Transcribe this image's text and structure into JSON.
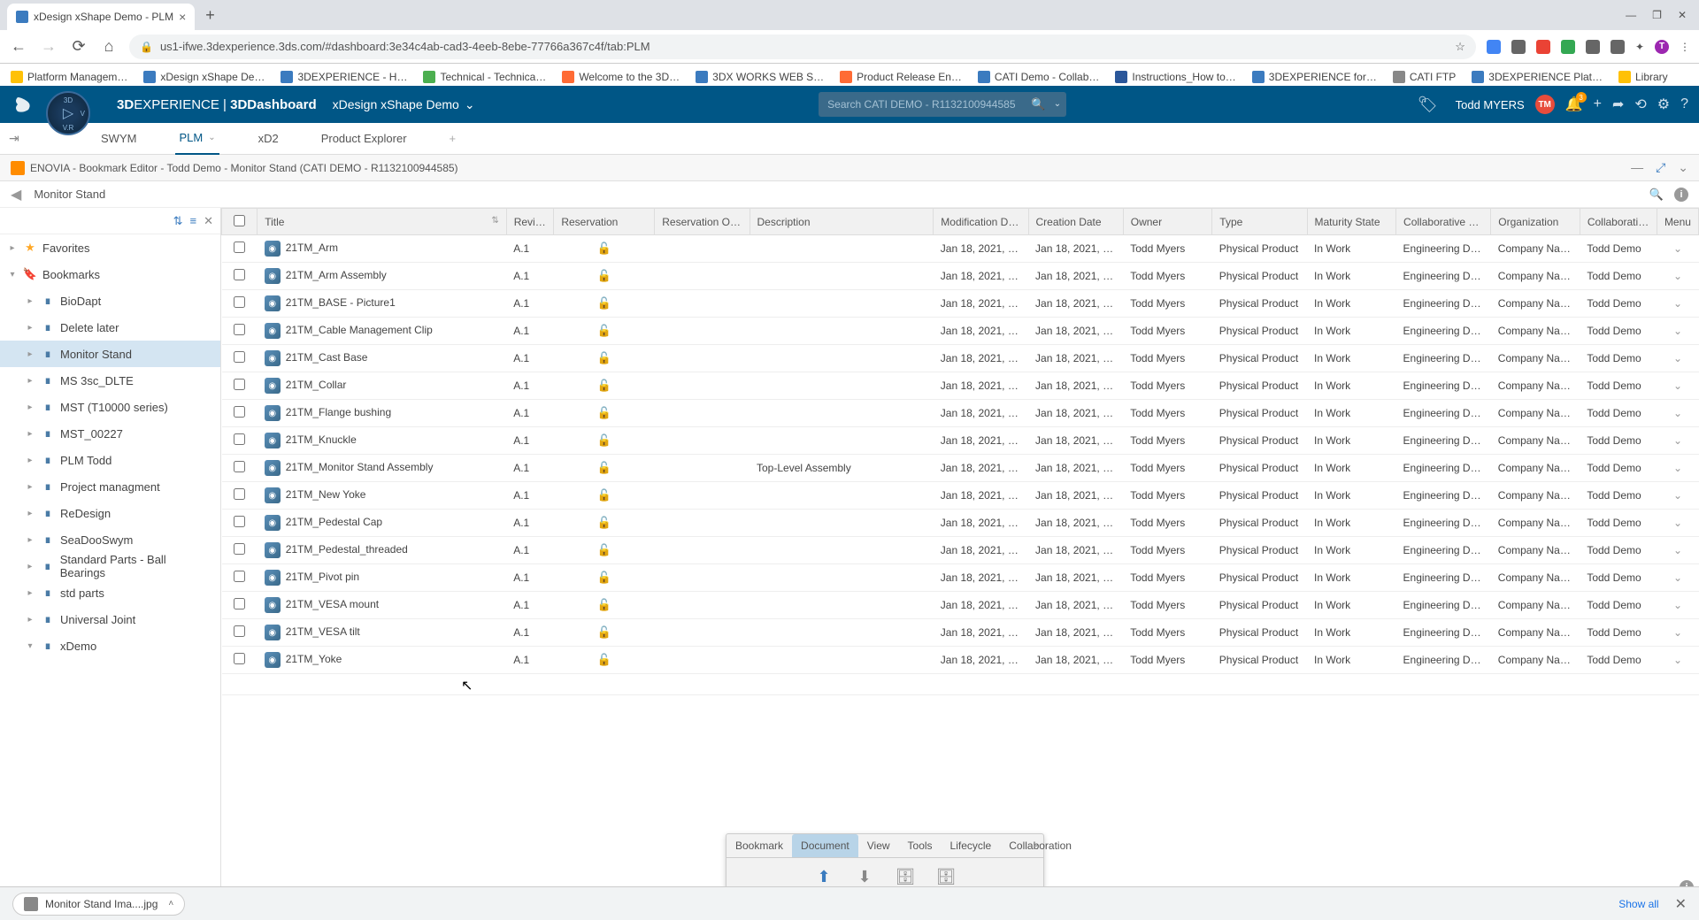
{
  "browser": {
    "tabTitle": "xDesign xShape Demo - PLM",
    "url": "us1-ifwe.3dexperience.3ds.com/#dashboard:3e34c4ab-cad3-4eeb-8ebe-77766a367c4f/tab:PLM",
    "bookmarks": [
      "Platform Managem…",
      "xDesign xShape De…",
      "3DEXPERIENCE - H…",
      "Technical - Technica…",
      "Welcome to the 3D…",
      "3DX WORKS WEB S…",
      "Product Release En…",
      "CATI Demo - Collab…",
      "Instructions_How to…",
      "3DEXPERIENCE for…",
      "CATI FTP",
      "3DEXPERIENCE Plat…",
      "Library"
    ]
  },
  "header": {
    "brandBold": "3D",
    "brandRest": "EXPERIENCE | ",
    "brandApp": "3DDashboard",
    "appName": "xDesign xShape Demo",
    "searchPlaceholder": "Search CATI DEMO - R1132100944585",
    "userName": "Todd MYERS",
    "userInitials": "TM",
    "notifCount": "3"
  },
  "tabs": [
    "SWYM",
    "PLM",
    "xD2",
    "Product Explorer"
  ],
  "widget": {
    "title": "ENOVIA - Bookmark Editor - Todd Demo - Monitor Stand (CATI DEMO - R1132100944585)"
  },
  "breadcrumb": "Monitor Stand",
  "sidebar": {
    "favorites": "Favorites",
    "bookmarks": "Bookmarks",
    "items": [
      "BioDapt",
      "Delete later",
      "Monitor Stand",
      "MS 3sc_DLTE",
      "MST (T10000 series)",
      "MST_00227",
      "PLM Todd",
      "Project managment",
      "ReDesign",
      "SeaDooSwym",
      "Standard Parts - Ball Bearings",
      "std parts",
      "Universal Joint",
      "xDemo"
    ],
    "selectedIndex": 2
  },
  "columns": [
    "",
    "Title",
    "Revi…",
    "Reservation",
    "Reservation O…",
    "Description",
    "Modification D…",
    "Creation Date",
    "Owner",
    "Type",
    "Maturity State",
    "Collaborative …",
    "Organization",
    "Collaborative …",
    "Menu"
  ],
  "rows": [
    {
      "title": "21TM_Arm",
      "rev": "A.1",
      "desc": "",
      "mod": "Jan 18, 2021, …",
      "cre": "Jan 18, 2021, …",
      "owner": "Todd Myers",
      "type": "Physical Product",
      "mat": "In Work",
      "pol": "Engineering D…",
      "org": "Company Name",
      "collab": "Todd Demo"
    },
    {
      "title": "21TM_Arm Assembly",
      "rev": "A.1",
      "desc": "",
      "mod": "Jan 18, 2021, …",
      "cre": "Jan 18, 2021, …",
      "owner": "Todd Myers",
      "type": "Physical Product",
      "mat": "In Work",
      "pol": "Engineering D…",
      "org": "Company Name",
      "collab": "Todd Demo"
    },
    {
      "title": "21TM_BASE - Picture1",
      "rev": "A.1",
      "desc": "",
      "mod": "Jan 18, 2021, …",
      "cre": "Jan 18, 2021, …",
      "owner": "Todd Myers",
      "type": "Physical Product",
      "mat": "In Work",
      "pol": "Engineering D…",
      "org": "Company Name",
      "collab": "Todd Demo"
    },
    {
      "title": "21TM_Cable Management Clip",
      "rev": "A.1",
      "desc": "",
      "mod": "Jan 18, 2021, …",
      "cre": "Jan 18, 2021, …",
      "owner": "Todd Myers",
      "type": "Physical Product",
      "mat": "In Work",
      "pol": "Engineering D…",
      "org": "Company Name",
      "collab": "Todd Demo"
    },
    {
      "title": "21TM_Cast Base",
      "rev": "A.1",
      "desc": "",
      "mod": "Jan 18, 2021, …",
      "cre": "Jan 18, 2021, …",
      "owner": "Todd Myers",
      "type": "Physical Product",
      "mat": "In Work",
      "pol": "Engineering D…",
      "org": "Company Name",
      "collab": "Todd Demo"
    },
    {
      "title": "21TM_Collar",
      "rev": "A.1",
      "desc": "",
      "mod": "Jan 18, 2021, …",
      "cre": "Jan 18, 2021, …",
      "owner": "Todd Myers",
      "type": "Physical Product",
      "mat": "In Work",
      "pol": "Engineering D…",
      "org": "Company Name",
      "collab": "Todd Demo"
    },
    {
      "title": "21TM_Flange bushing",
      "rev": "A.1",
      "desc": "",
      "mod": "Jan 18, 2021, …",
      "cre": "Jan 18, 2021, …",
      "owner": "Todd Myers",
      "type": "Physical Product",
      "mat": "In Work",
      "pol": "Engineering D…",
      "org": "Company Name",
      "collab": "Todd Demo"
    },
    {
      "title": "21TM_Knuckle",
      "rev": "A.1",
      "desc": "",
      "mod": "Jan 18, 2021, …",
      "cre": "Jan 18, 2021, …",
      "owner": "Todd Myers",
      "type": "Physical Product",
      "mat": "In Work",
      "pol": "Engineering D…",
      "org": "Company Name",
      "collab": "Todd Demo"
    },
    {
      "title": "21TM_Monitor Stand Assembly",
      "rev": "A.1",
      "desc": "Top-Level Assembly",
      "mod": "Jan 18, 2021, …",
      "cre": "Jan 18, 2021, …",
      "owner": "Todd Myers",
      "type": "Physical Product",
      "mat": "In Work",
      "pol": "Engineering D…",
      "org": "Company Name",
      "collab": "Todd Demo"
    },
    {
      "title": "21TM_New Yoke",
      "rev": "A.1",
      "desc": "",
      "mod": "Jan 18, 2021, …",
      "cre": "Jan 18, 2021, …",
      "owner": "Todd Myers",
      "type": "Physical Product",
      "mat": "In Work",
      "pol": "Engineering D…",
      "org": "Company Name",
      "collab": "Todd Demo"
    },
    {
      "title": "21TM_Pedestal Cap",
      "rev": "A.1",
      "desc": "",
      "mod": "Jan 18, 2021, …",
      "cre": "Jan 18, 2021, …",
      "owner": "Todd Myers",
      "type": "Physical Product",
      "mat": "In Work",
      "pol": "Engineering D…",
      "org": "Company Name",
      "collab": "Todd Demo"
    },
    {
      "title": "21TM_Pedestal_threaded",
      "rev": "A.1",
      "desc": "",
      "mod": "Jan 18, 2021, …",
      "cre": "Jan 18, 2021, …",
      "owner": "Todd Myers",
      "type": "Physical Product",
      "mat": "In Work",
      "pol": "Engineering D…",
      "org": "Company Name",
      "collab": "Todd Demo"
    },
    {
      "title": "21TM_Pivot pin",
      "rev": "A.1",
      "desc": "",
      "mod": "Jan 18, 2021, …",
      "cre": "Jan 18, 2021, …",
      "owner": "Todd Myers",
      "type": "Physical Product",
      "mat": "In Work",
      "pol": "Engineering D…",
      "org": "Company Name",
      "collab": "Todd Demo"
    },
    {
      "title": "21TM_VESA mount",
      "rev": "A.1",
      "desc": "",
      "mod": "Jan 18, 2021, …",
      "cre": "Jan 18, 2021, …",
      "owner": "Todd Myers",
      "type": "Physical Product",
      "mat": "In Work",
      "pol": "Engineering D…",
      "org": "Company Name",
      "collab": "Todd Demo"
    },
    {
      "title": "21TM_VESA tilt",
      "rev": "A.1",
      "desc": "",
      "mod": "Jan 18, 2021, …",
      "cre": "Jan 18, 2021, …",
      "owner": "Todd Myers",
      "type": "Physical Product",
      "mat": "In Work",
      "pol": "Engineering D…",
      "org": "Company Name",
      "collab": "Todd Demo"
    },
    {
      "title": "21TM_Yoke",
      "rev": "A.1",
      "desc": "",
      "mod": "Jan 18, 2021, …",
      "cre": "Jan 18, 2021, …",
      "owner": "Todd Myers",
      "type": "Physical Product",
      "mat": "In Work",
      "pol": "Engineering D…",
      "org": "Company Name",
      "collab": "Todd Demo"
    }
  ],
  "floatToolbar": {
    "tabs": [
      "Bookmark",
      "Document",
      "View",
      "Tools",
      "Lifecycle",
      "Collaboration"
    ],
    "activeTab": 1
  },
  "download": {
    "filename": "Monitor Stand Ima....jpg",
    "showAll": "Show all"
  }
}
